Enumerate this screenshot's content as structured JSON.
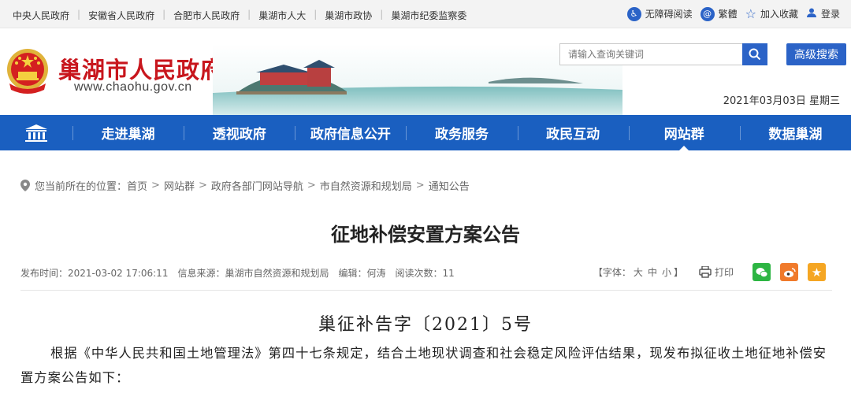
{
  "topbar": {
    "links": [
      "中央人民政府",
      "安徽省人民政府",
      "合肥市人民政府",
      "巢湖市人大",
      "巢湖市政协",
      "巢湖市纪委监察委"
    ],
    "accessibility": "无障碍阅读",
    "traditional": "繁體",
    "favorite": "加入收藏",
    "login": "登录"
  },
  "header": {
    "site_title": "巢湖市人民政府",
    "site_domain": "www.chaohu.gov.cn",
    "search_placeholder": "请输入查询关键词",
    "advanced_search": "高级搜索",
    "date": "2021年03月03日 星期三"
  },
  "nav": {
    "items": [
      "走进巢湖",
      "透视政府",
      "政府信息公开",
      "政务服务",
      "政民互动",
      "网站群",
      "数据巢湖"
    ],
    "active": "网站群"
  },
  "breadcrumb": {
    "prefix": "您当前所在的位置：",
    "items": [
      "首页",
      "网站群",
      "政府各部门网站导航",
      "市自然资源和规划局",
      "通知公告"
    ]
  },
  "article": {
    "title": "征地补偿安置方案公告",
    "publish_time": "发布时间：2021-03-02 17:06:11",
    "source": "信息来源：巢湖市自然资源和规划局",
    "editor": "编辑：何涛",
    "views": "阅读次数：11",
    "font_label": "【字体：",
    "font_large": "大",
    "font_medium": "中",
    "font_small": "小",
    "font_close": "】",
    "print": "打印",
    "doc_number": "巢征补告字〔2021〕5号",
    "paragraph": "根据《中华人民共和国土地管理法》第四十七条规定，结合土地现状调查和社会稳定风险评估结果，现发布拟征收土地征地补偿安置方案公告如下："
  },
  "colors": {
    "nav_bg": "#1a5fc0",
    "title_red": "#c8161d",
    "button_blue": "#2b63c7",
    "wechat": "#2db543",
    "weibo": "#f07a2b",
    "favorite": "#f5a623"
  }
}
